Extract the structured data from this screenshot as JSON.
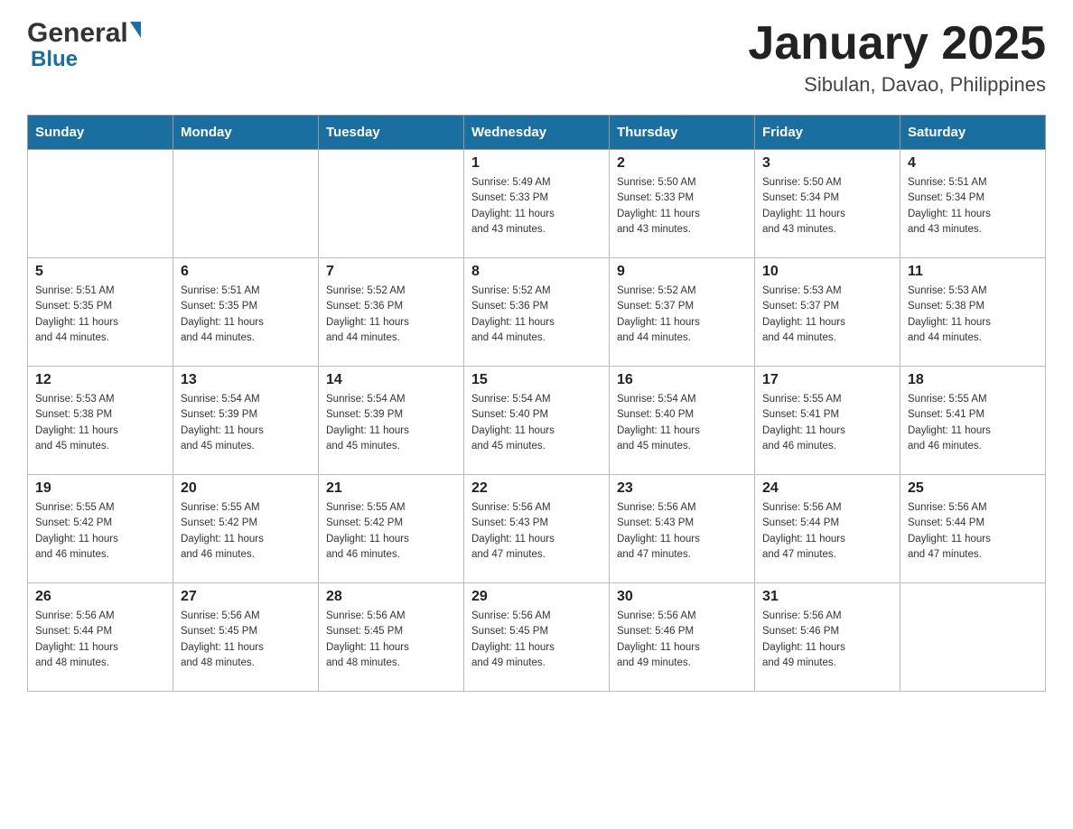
{
  "header": {
    "title": "January 2025",
    "subtitle": "Sibulan, Davao, Philippines",
    "logo_general": "General",
    "logo_blue": "Blue"
  },
  "days": [
    "Sunday",
    "Monday",
    "Tuesday",
    "Wednesday",
    "Thursday",
    "Friday",
    "Saturday"
  ],
  "weeks": [
    [
      {
        "date": "",
        "info": ""
      },
      {
        "date": "",
        "info": ""
      },
      {
        "date": "",
        "info": ""
      },
      {
        "date": "1",
        "info": "Sunrise: 5:49 AM\nSunset: 5:33 PM\nDaylight: 11 hours\nand 43 minutes."
      },
      {
        "date": "2",
        "info": "Sunrise: 5:50 AM\nSunset: 5:33 PM\nDaylight: 11 hours\nand 43 minutes."
      },
      {
        "date": "3",
        "info": "Sunrise: 5:50 AM\nSunset: 5:34 PM\nDaylight: 11 hours\nand 43 minutes."
      },
      {
        "date": "4",
        "info": "Sunrise: 5:51 AM\nSunset: 5:34 PM\nDaylight: 11 hours\nand 43 minutes."
      }
    ],
    [
      {
        "date": "5",
        "info": "Sunrise: 5:51 AM\nSunset: 5:35 PM\nDaylight: 11 hours\nand 44 minutes."
      },
      {
        "date": "6",
        "info": "Sunrise: 5:51 AM\nSunset: 5:35 PM\nDaylight: 11 hours\nand 44 minutes."
      },
      {
        "date": "7",
        "info": "Sunrise: 5:52 AM\nSunset: 5:36 PM\nDaylight: 11 hours\nand 44 minutes."
      },
      {
        "date": "8",
        "info": "Sunrise: 5:52 AM\nSunset: 5:36 PM\nDaylight: 11 hours\nand 44 minutes."
      },
      {
        "date": "9",
        "info": "Sunrise: 5:52 AM\nSunset: 5:37 PM\nDaylight: 11 hours\nand 44 minutes."
      },
      {
        "date": "10",
        "info": "Sunrise: 5:53 AM\nSunset: 5:37 PM\nDaylight: 11 hours\nand 44 minutes."
      },
      {
        "date": "11",
        "info": "Sunrise: 5:53 AM\nSunset: 5:38 PM\nDaylight: 11 hours\nand 44 minutes."
      }
    ],
    [
      {
        "date": "12",
        "info": "Sunrise: 5:53 AM\nSunset: 5:38 PM\nDaylight: 11 hours\nand 45 minutes."
      },
      {
        "date": "13",
        "info": "Sunrise: 5:54 AM\nSunset: 5:39 PM\nDaylight: 11 hours\nand 45 minutes."
      },
      {
        "date": "14",
        "info": "Sunrise: 5:54 AM\nSunset: 5:39 PM\nDaylight: 11 hours\nand 45 minutes."
      },
      {
        "date": "15",
        "info": "Sunrise: 5:54 AM\nSunset: 5:40 PM\nDaylight: 11 hours\nand 45 minutes."
      },
      {
        "date": "16",
        "info": "Sunrise: 5:54 AM\nSunset: 5:40 PM\nDaylight: 11 hours\nand 45 minutes."
      },
      {
        "date": "17",
        "info": "Sunrise: 5:55 AM\nSunset: 5:41 PM\nDaylight: 11 hours\nand 46 minutes."
      },
      {
        "date": "18",
        "info": "Sunrise: 5:55 AM\nSunset: 5:41 PM\nDaylight: 11 hours\nand 46 minutes."
      }
    ],
    [
      {
        "date": "19",
        "info": "Sunrise: 5:55 AM\nSunset: 5:42 PM\nDaylight: 11 hours\nand 46 minutes."
      },
      {
        "date": "20",
        "info": "Sunrise: 5:55 AM\nSunset: 5:42 PM\nDaylight: 11 hours\nand 46 minutes."
      },
      {
        "date": "21",
        "info": "Sunrise: 5:55 AM\nSunset: 5:42 PM\nDaylight: 11 hours\nand 46 minutes."
      },
      {
        "date": "22",
        "info": "Sunrise: 5:56 AM\nSunset: 5:43 PM\nDaylight: 11 hours\nand 47 minutes."
      },
      {
        "date": "23",
        "info": "Sunrise: 5:56 AM\nSunset: 5:43 PM\nDaylight: 11 hours\nand 47 minutes."
      },
      {
        "date": "24",
        "info": "Sunrise: 5:56 AM\nSunset: 5:44 PM\nDaylight: 11 hours\nand 47 minutes."
      },
      {
        "date": "25",
        "info": "Sunrise: 5:56 AM\nSunset: 5:44 PM\nDaylight: 11 hours\nand 47 minutes."
      }
    ],
    [
      {
        "date": "26",
        "info": "Sunrise: 5:56 AM\nSunset: 5:44 PM\nDaylight: 11 hours\nand 48 minutes."
      },
      {
        "date": "27",
        "info": "Sunrise: 5:56 AM\nSunset: 5:45 PM\nDaylight: 11 hours\nand 48 minutes."
      },
      {
        "date": "28",
        "info": "Sunrise: 5:56 AM\nSunset: 5:45 PM\nDaylight: 11 hours\nand 48 minutes."
      },
      {
        "date": "29",
        "info": "Sunrise: 5:56 AM\nSunset: 5:45 PM\nDaylight: 11 hours\nand 49 minutes."
      },
      {
        "date": "30",
        "info": "Sunrise: 5:56 AM\nSunset: 5:46 PM\nDaylight: 11 hours\nand 49 minutes."
      },
      {
        "date": "31",
        "info": "Sunrise: 5:56 AM\nSunset: 5:46 PM\nDaylight: 11 hours\nand 49 minutes."
      },
      {
        "date": "",
        "info": ""
      }
    ]
  ]
}
